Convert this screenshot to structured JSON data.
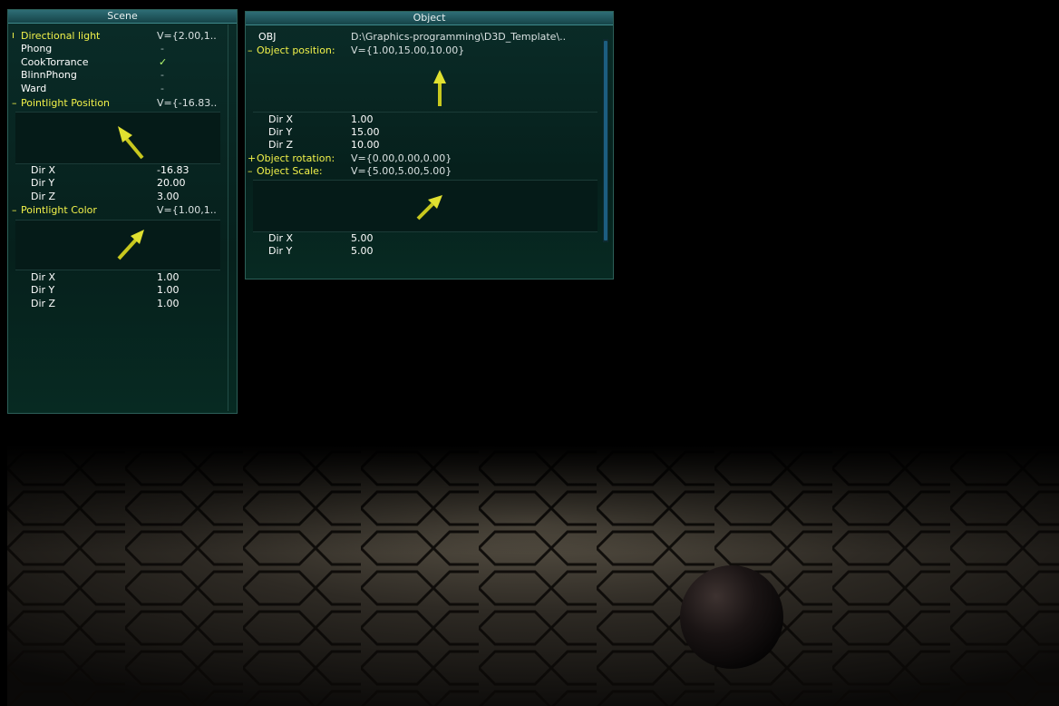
{
  "scene_panel": {
    "title": "Scene",
    "rows": [
      {
        "label": "Directional light",
        "value": "V={2.00,1..",
        "marker": "ı"
      },
      {
        "label": "Phong",
        "value": "-"
      },
      {
        "label": "CookTorrance",
        "value": "✓"
      },
      {
        "label": "BlinnPhong",
        "value": "-"
      },
      {
        "label": "Ward",
        "value": "-"
      },
      {
        "label": "Pointlight Position",
        "value": "V={-16.83..",
        "marker": "–"
      }
    ],
    "pointlight_position": {
      "dir_x_label": "Dir X",
      "dir_x": "-16.83",
      "dir_y_label": "Dir Y",
      "dir_y": "20.00",
      "dir_z_label": "Dir Z",
      "dir_z": "3.00"
    },
    "pointlight_color": {
      "label": "Pointlight Color",
      "value": "V={1.00,1..",
      "marker": "–",
      "dir_x_label": "Dir X",
      "dir_x": "1.00",
      "dir_y_label": "Dir Y",
      "dir_y": "1.00",
      "dir_z_label": "Dir Z",
      "dir_z": "1.00"
    }
  },
  "object_panel": {
    "title": "Object",
    "obj_label": "OBJ",
    "obj_path": "D:\\Graphics-programming\\D3D_Template\\..",
    "position": {
      "label": "Object position:",
      "value": "V={1.00,15.00,10.00}",
      "marker": "–",
      "dir_x_label": "Dir X",
      "dir_x": "1.00",
      "dir_y_label": "Dir Y",
      "dir_y": "15.00",
      "dir_z_label": "Dir Z",
      "dir_z": "10.00"
    },
    "rotation": {
      "label": "Object rotation:",
      "value": "V={0.00,0.00,0.00}",
      "marker": "+"
    },
    "scale": {
      "label": "Object Scale:",
      "value": "V={5.00,5.00,5.00}",
      "marker": "–",
      "dir_x_label": "Dir X",
      "dir_x": "5.00",
      "dir_y_label": "Dir Y",
      "dir_y": "5.00"
    }
  },
  "colors": {
    "highlight_label": "#f2f24a",
    "arrow": "#c8c81e",
    "panel_bg": "#06201c",
    "title_bar": "#2e6d76"
  }
}
